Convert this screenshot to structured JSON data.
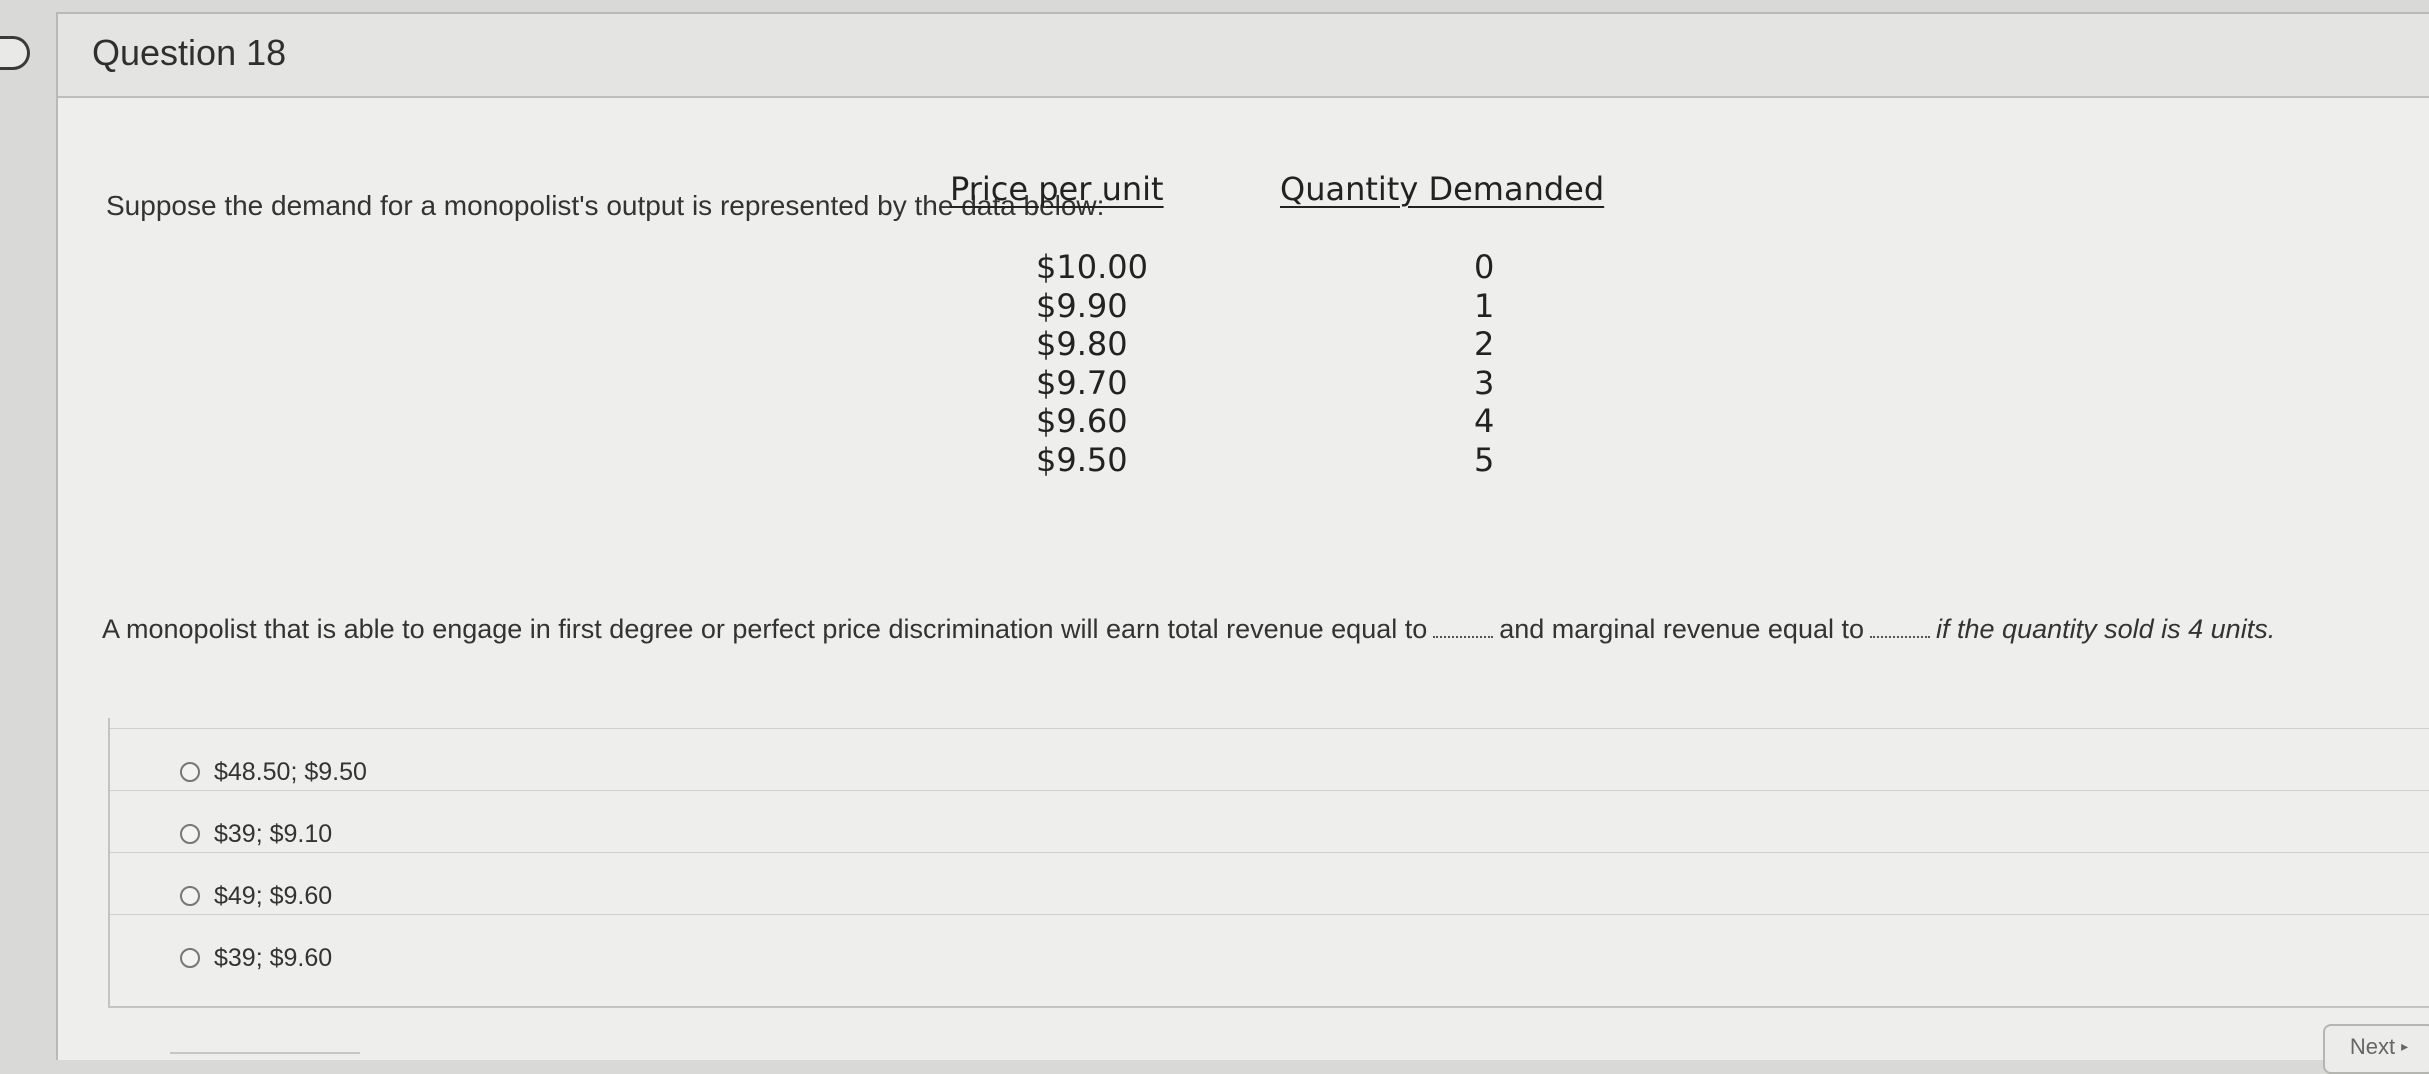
{
  "question": {
    "title": "Question 18",
    "stem": "Suppose the demand for a monopolist's output is represented by the data below:",
    "table": {
      "headers": [
        "Price per unit",
        "Quantity Demanded"
      ],
      "rows": [
        {
          "price": "$10.00",
          "quantity": "0"
        },
        {
          "price": "$9.90",
          "quantity": "1"
        },
        {
          "price": "$9.80",
          "quantity": "2"
        },
        {
          "price": "$9.70",
          "quantity": "3"
        },
        {
          "price": "$9.60",
          "quantity": "4"
        },
        {
          "price": "$9.50",
          "quantity": "5"
        }
      ]
    },
    "prompt": {
      "part1": "A monopolist that is able to engage in first degree or perfect price discrimination will earn total revenue equal to",
      "part2": "and marginal revenue equal to",
      "part3": "if the quantity sold is 4 units."
    },
    "options": [
      {
        "label": "$48.50; $9.50"
      },
      {
        "label": "$39; $9.10"
      },
      {
        "label": "$49; $9.60"
      },
      {
        "label": "$39; $9.60"
      }
    ]
  },
  "navigation": {
    "next_label": "Next"
  },
  "icons": {
    "flag": "flag-marker-icon",
    "radio": "radio-button-icon",
    "next_arrow": "caret-right-icon"
  }
}
